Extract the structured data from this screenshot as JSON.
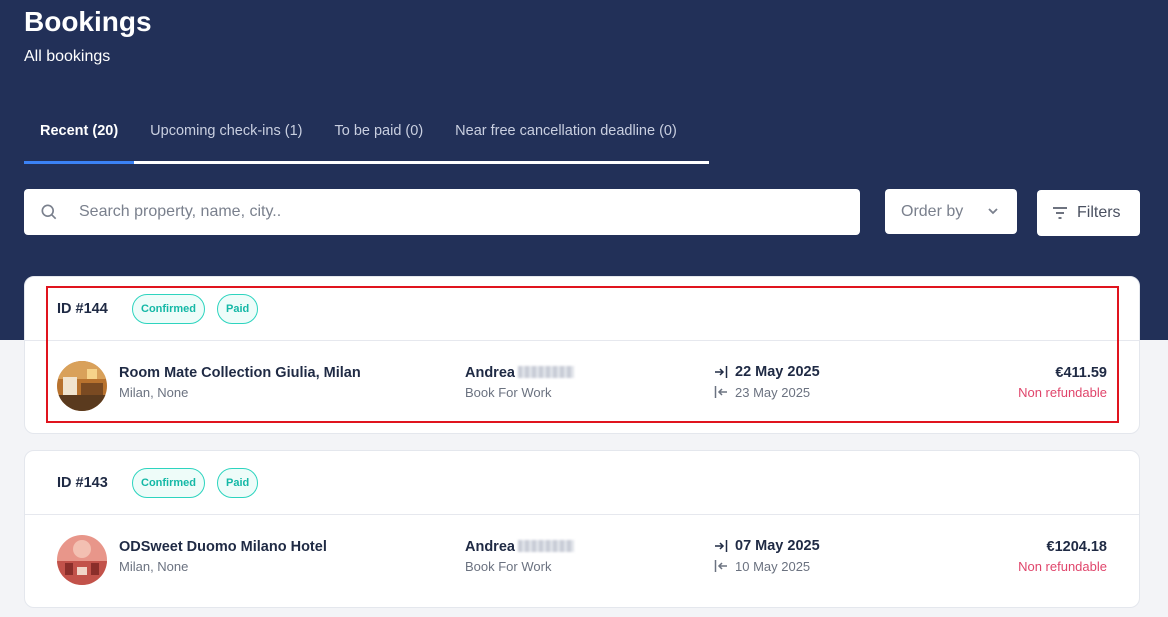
{
  "header": {
    "title": "Bookings",
    "subtitle": "All bookings"
  },
  "tabs": [
    {
      "label": "Recent (20)",
      "active": true
    },
    {
      "label": "Upcoming check-ins (1)",
      "active": false
    },
    {
      "label": "To be paid (0)",
      "active": false
    },
    {
      "label": "Near free cancellation deadline (0)",
      "active": false
    }
  ],
  "search": {
    "placeholder": "Search property, name, city..",
    "value": "",
    "icon": "search-icon"
  },
  "order_by": {
    "label": "Order by",
    "icon": "chevron-down-icon"
  },
  "filters": {
    "label": "Filters",
    "icon": "filter-icon"
  },
  "bookings": [
    {
      "id": "ID #144",
      "badges": [
        "Confirmed",
        "Paid"
      ],
      "property": "Room Mate Collection Giulia, Milan",
      "location": "Milan, None",
      "guest_first_name": "Andrea",
      "company": "Book For Work",
      "checkin": "22 May 2025",
      "checkout": "23 May 2025",
      "price": "€411.59",
      "refund_policy": "Non refundable"
    },
    {
      "id": "ID #143",
      "badges": [
        "Confirmed",
        "Paid"
      ],
      "property": "ODSweet Duomo Milano Hotel",
      "location": "Milan, None",
      "guest_first_name": "Andrea",
      "company": "Book For Work",
      "checkin": "07 May 2025",
      "checkout": "10 May 2025",
      "price": "€1204.18",
      "refund_policy": "Non refundable"
    }
  ],
  "colors": {
    "header_bg": "#223058",
    "active_tab_underline": "#3b82f6",
    "badge_teal": "#14b8a6",
    "refund_red": "#e0456b",
    "highlight_red": "#e0141e"
  }
}
